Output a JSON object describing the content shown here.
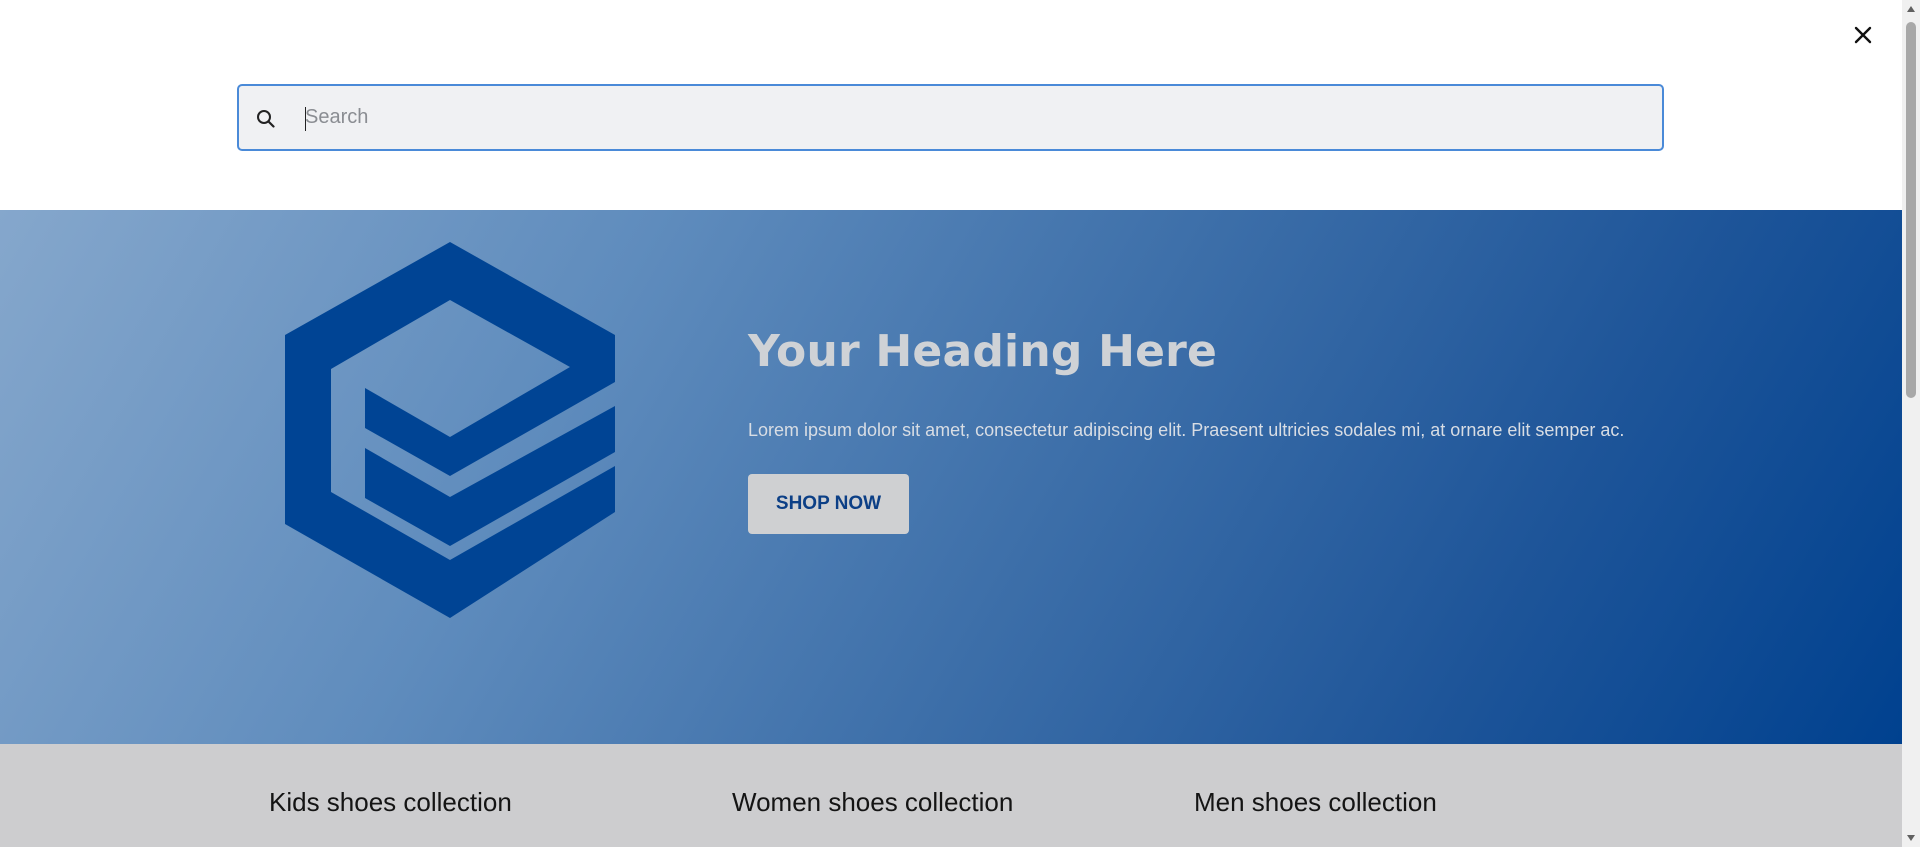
{
  "search": {
    "placeholder": "Search",
    "value": "",
    "border_color": "#4a8ad8",
    "background": "#f0f1f3"
  },
  "icons": {
    "search": "search-icon",
    "close": "close-icon",
    "logo": "stacked-hexagon-logo",
    "scroll_up": "scroll-up-arrow-icon",
    "scroll_down": "scroll-down-arrow-icon"
  },
  "hero": {
    "heading": "Your Heading Here",
    "text": "Lorem ipsum dolor sit amet, consectetur adipiscing elit. Praesent ultricies sodales mi, at ornare elit semper ac.",
    "button_label": "SHOP NOW",
    "gradient_start": "#85a7cc",
    "gradient_end": "#00418f",
    "logo_color": "#004494"
  },
  "collections": [
    {
      "label": "Kids shoes collection"
    },
    {
      "label": "Women shoes collection"
    },
    {
      "label": "Men shoes collection"
    }
  ]
}
